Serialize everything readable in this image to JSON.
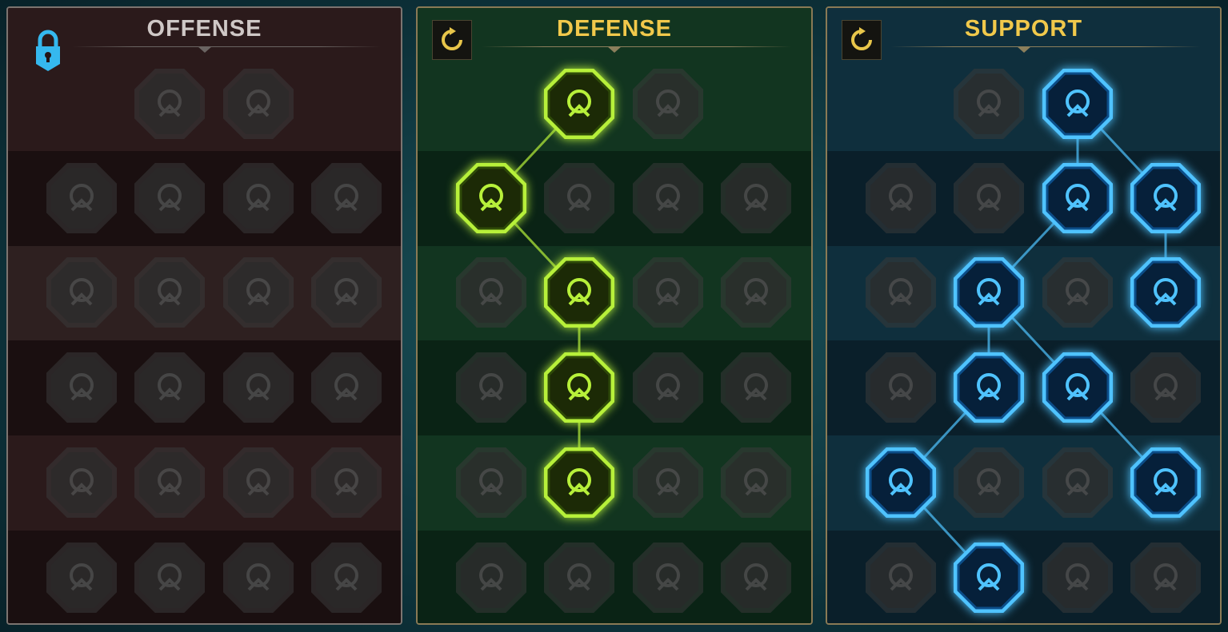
{
  "trees": [
    {
      "id": "offense",
      "title": "OFFENSE",
      "locked": true,
      "active": [],
      "links": [],
      "nodes": [
        {
          "r": 0,
          "c": 1,
          "icon": "crossed-swords-icon"
        },
        {
          "r": 0,
          "c": 2,
          "icon": "claw-dagger-icon"
        },
        {
          "r": 1,
          "c": 0,
          "icon": "horned-warrior-icon"
        },
        {
          "r": 1,
          "c": 1,
          "icon": "sword-banner-icon"
        },
        {
          "r": 1,
          "c": 2,
          "icon": "pierced-shield-icon"
        },
        {
          "r": 1,
          "c": 3,
          "icon": "bleeding-heart-icon"
        },
        {
          "r": 2,
          "c": 0,
          "icon": "arrow-volley-icon"
        },
        {
          "r": 2,
          "c": 1,
          "icon": "fanged-maw-icon"
        },
        {
          "r": 2,
          "c": 2,
          "icon": "skull-cloak-icon"
        },
        {
          "r": 2,
          "c": 3,
          "icon": "fist-blade-icon"
        },
        {
          "r": 3,
          "c": 0,
          "icon": "heart-sword-icon"
        },
        {
          "r": 3,
          "c": 1,
          "icon": "gauntlet-icon"
        },
        {
          "r": 3,
          "c": 2,
          "icon": "axe-icon"
        },
        {
          "r": 3,
          "c": 3,
          "icon": "lightning-chain-icon"
        },
        {
          "r": 4,
          "c": 0,
          "icon": "blades-bowl-icon"
        },
        {
          "r": 4,
          "c": 1,
          "icon": "skulls-icon"
        },
        {
          "r": 4,
          "c": 2,
          "icon": "sword-ring-icon"
        },
        {
          "r": 4,
          "c": 3,
          "icon": "shock-warrior-icon"
        },
        {
          "r": 5,
          "c": 0,
          "icon": "sparkle-sword-icon"
        },
        {
          "r": 5,
          "c": 1,
          "icon": "knight-helm-icon"
        },
        {
          "r": 5,
          "c": 2,
          "icon": "horned-demon-icon"
        },
        {
          "r": 5,
          "c": 3,
          "icon": "spartan-skull-icon"
        }
      ]
    },
    {
      "id": "defense",
      "title": "DEFENSE",
      "locked": false,
      "active": [
        [
          0,
          1
        ],
        [
          1,
          0
        ],
        [
          2,
          1
        ],
        [
          3,
          1
        ],
        [
          4,
          1
        ]
      ],
      "links": [
        [
          [
            0,
            1
          ],
          [
            1,
            0
          ]
        ],
        [
          [
            1,
            0
          ],
          [
            2,
            1
          ]
        ],
        [
          [
            2,
            1
          ],
          [
            3,
            1
          ]
        ],
        [
          [
            3,
            1
          ],
          [
            4,
            1
          ]
        ]
      ],
      "nodes": [
        {
          "r": 0,
          "c": 1,
          "icon": "armor-plates-icon"
        },
        {
          "r": 0,
          "c": 2,
          "icon": "fist-icon"
        },
        {
          "r": 1,
          "c": 0,
          "icon": "chevron-shield-icon"
        },
        {
          "r": 1,
          "c": 1,
          "icon": "heart-vase-icon"
        },
        {
          "r": 1,
          "c": 2,
          "icon": "stone-golem-icon"
        },
        {
          "r": 1,
          "c": 3,
          "icon": "parry-blades-icon"
        },
        {
          "r": 2,
          "c": 0,
          "icon": "ghost-fighter-icon"
        },
        {
          "r": 2,
          "c": 1,
          "icon": "knight-shield-icon"
        },
        {
          "r": 2,
          "c": 2,
          "icon": "skull-heart-icon"
        },
        {
          "r": 2,
          "c": 3,
          "icon": "aura-head-icon"
        },
        {
          "r": 3,
          "c": 0,
          "icon": "crowd-icon"
        },
        {
          "r": 3,
          "c": 1,
          "icon": "skull-hourglass-icon"
        },
        {
          "r": 3,
          "c": 2,
          "icon": "hand-drop-icon"
        },
        {
          "r": 3,
          "c": 3,
          "icon": "bull-icon"
        },
        {
          "r": 4,
          "c": 0,
          "icon": "dash-runner-icon"
        },
        {
          "r": 4,
          "c": 1,
          "icon": "blood-drops-icon"
        },
        {
          "r": 4,
          "c": 2,
          "icon": "skull-sun-icon"
        },
        {
          "r": 4,
          "c": 3,
          "icon": "deflect-hand-icon"
        },
        {
          "r": 5,
          "c": 0,
          "icon": "crowned-face-icon"
        },
        {
          "r": 5,
          "c": 1,
          "icon": "winged-shield-icon"
        },
        {
          "r": 5,
          "c": 2,
          "icon": "bearded-face-icon"
        },
        {
          "r": 5,
          "c": 3,
          "icon": "flexing-figure-icon"
        }
      ]
    },
    {
      "id": "support",
      "title": "SUPPORT",
      "locked": false,
      "active": [
        [
          0,
          2
        ],
        [
          1,
          2
        ],
        [
          1,
          3
        ],
        [
          2,
          1
        ],
        [
          2,
          3
        ],
        [
          3,
          1
        ],
        [
          3,
          2
        ],
        [
          4,
          0
        ],
        [
          4,
          3
        ],
        [
          5,
          1
        ]
      ],
      "links": [
        [
          [
            0,
            2
          ],
          [
            1,
            2
          ]
        ],
        [
          [
            0,
            2
          ],
          [
            1,
            3
          ]
        ],
        [
          [
            1,
            2
          ],
          [
            2,
            1
          ]
        ],
        [
          [
            1,
            3
          ],
          [
            2,
            3
          ]
        ],
        [
          [
            2,
            1
          ],
          [
            3,
            1
          ]
        ],
        [
          [
            2,
            1
          ],
          [
            3,
            2
          ]
        ],
        [
          [
            3,
            1
          ],
          [
            4,
            0
          ]
        ],
        [
          [
            3,
            2
          ],
          [
            4,
            3
          ]
        ],
        [
          [
            4,
            0
          ],
          [
            5,
            1
          ]
        ]
      ],
      "nodes": [
        {
          "r": 0,
          "c": 1,
          "icon": "heart-plus-icon"
        },
        {
          "r": 0,
          "c": 2,
          "icon": "meteor-disc-icon"
        },
        {
          "r": 1,
          "c": 0,
          "icon": "praying-hands-icon"
        },
        {
          "r": 1,
          "c": 1,
          "icon": "ring-shield-icon"
        },
        {
          "r": 1,
          "c": 2,
          "icon": "flaming-skull-icon"
        },
        {
          "r": 1,
          "c": 3,
          "icon": "swift-hand-icon"
        },
        {
          "r": 2,
          "c": 0,
          "icon": "healing-figure-icon"
        },
        {
          "r": 2,
          "c": 1,
          "icon": "lightning-bolt-icon"
        },
        {
          "r": 2,
          "c": 2,
          "icon": "cracked-stone-icon"
        },
        {
          "r": 2,
          "c": 3,
          "icon": "shadow-figure-icon"
        },
        {
          "r": 3,
          "c": 0,
          "icon": "chained-heart-icon"
        },
        {
          "r": 3,
          "c": 1,
          "icon": "comet-icon"
        },
        {
          "r": 3,
          "c": 2,
          "icon": "open-book-icon"
        },
        {
          "r": 3,
          "c": 3,
          "icon": "angry-eyes-icon"
        },
        {
          "r": 4,
          "c": 0,
          "icon": "compass-star-icon"
        },
        {
          "r": 4,
          "c": 1,
          "icon": "speed-boot-icon"
        },
        {
          "r": 4,
          "c": 2,
          "icon": "eye-icon"
        },
        {
          "r": 4,
          "c": 3,
          "icon": "voodoo-doll-icon"
        },
        {
          "r": 5,
          "c": 0,
          "icon": "potion-icon"
        },
        {
          "r": 5,
          "c": 1,
          "icon": "thunder-skull-icon"
        },
        {
          "r": 5,
          "c": 2,
          "icon": "gauntlet-slam-icon"
        },
        {
          "r": 5,
          "c": 3,
          "icon": "eagle-icon"
        }
      ]
    }
  ],
  "colors": {
    "defense_active": "#b7f03a",
    "support_active": "#4fc3ff",
    "inactive": "#2e2e2e",
    "lock": "#35b8ee",
    "reset": "#e8c64a"
  }
}
